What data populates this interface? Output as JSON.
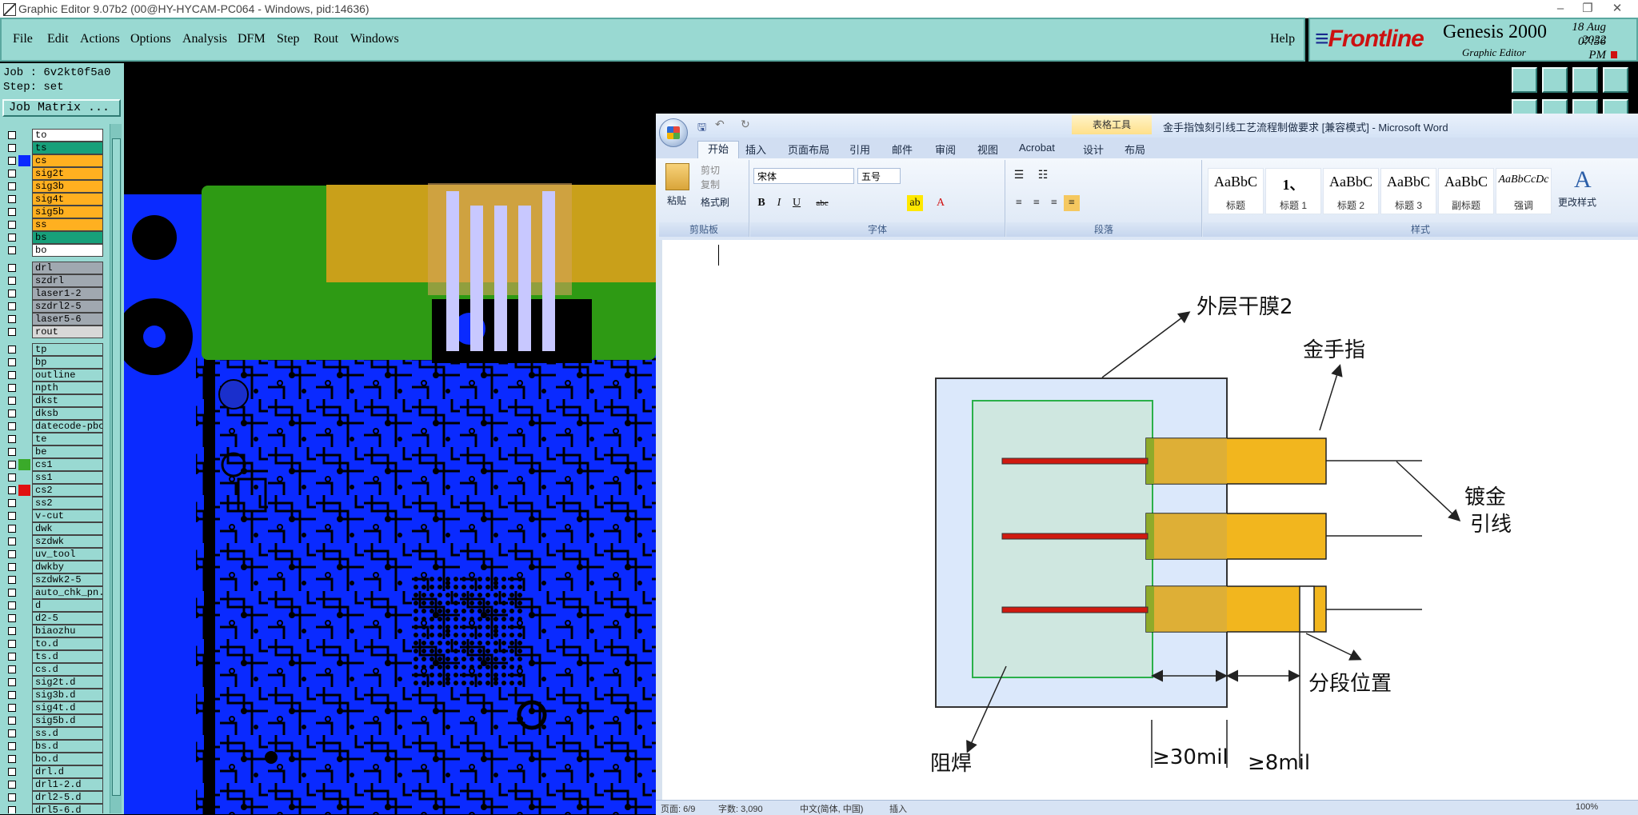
{
  "app_title": "Graphic Editor 9.07b2 (00@HY-HYCAM-PC064 - Windows, pid:14636)",
  "menu": [
    "File",
    "Edit",
    "Actions",
    "Options",
    "Analysis",
    "DFM",
    "Step",
    "Rout",
    "Windows"
  ],
  "help_label": "Help",
  "brand": {
    "logo": "Frontline",
    "product": "Genesis 2000",
    "module": "Graphic Editor",
    "date": "18 Aug 2022",
    "time": "07:56 PM"
  },
  "job_label": "Job : 6v2kt0f5a0",
  "step_label": "Step: set",
  "job_matrix_label": "Job Matrix ...",
  "layers": [
    {
      "name": "to",
      "color": "#ffffff",
      "swatch": ""
    },
    {
      "name": "ts",
      "color": "#17a07a",
      "swatch": ""
    },
    {
      "name": "cs",
      "color": "#ffb020",
      "swatch": "#0a2aff"
    },
    {
      "name": "sig2t",
      "color": "#ffb020",
      "swatch": ""
    },
    {
      "name": "sig3b",
      "color": "#ffb020",
      "swatch": ""
    },
    {
      "name": "sig4t",
      "color": "#ffb020",
      "swatch": ""
    },
    {
      "name": "sig5b",
      "color": "#ffb020",
      "swatch": ""
    },
    {
      "name": "ss",
      "color": "#ffb020",
      "swatch": ""
    },
    {
      "name": "bs",
      "color": "#17a07a",
      "swatch": ""
    },
    {
      "name": "bo",
      "color": "#ffffff",
      "swatch": ""
    },
    {
      "sep": true
    },
    {
      "name": "drl",
      "color": "#a0a8b0",
      "swatch": ""
    },
    {
      "name": "szdrl",
      "color": "#a0a8b0",
      "swatch": ""
    },
    {
      "name": "laser1-2",
      "color": "#a0a8b0",
      "swatch": ""
    },
    {
      "name": "szdrl2-5",
      "color": "#a0a8b0",
      "swatch": ""
    },
    {
      "name": "laser5-6",
      "color": "#a0a8b0",
      "swatch": ""
    },
    {
      "name": "rout",
      "color": "#d8d8d8",
      "swatch": ""
    },
    {
      "sep": true
    },
    {
      "name": "tp",
      "color": "#99d9d2",
      "swatch": ""
    },
    {
      "name": "bp",
      "color": "#99d9d2",
      "swatch": ""
    },
    {
      "name": "outline",
      "color": "#99d9d2",
      "swatch": ""
    },
    {
      "name": "npth",
      "color": "#99d9d2",
      "swatch": ""
    },
    {
      "name": "dkst",
      "color": "#99d9d2",
      "swatch": ""
    },
    {
      "name": "dksb",
      "color": "#99d9d2",
      "swatch": ""
    },
    {
      "name": "datecode-pbc",
      "color": "#99d9d2",
      "swatch": ""
    },
    {
      "name": "te",
      "color": "#99d9d2",
      "swatch": ""
    },
    {
      "name": "be",
      "color": "#99d9d2",
      "swatch": ""
    },
    {
      "name": "cs1",
      "color": "#99d9d2",
      "swatch": "#3aaa2a"
    },
    {
      "name": "ss1",
      "color": "#99d9d2",
      "swatch": ""
    },
    {
      "name": "cs2",
      "color": "#99d9d2",
      "swatch": "#e01010"
    },
    {
      "name": "ss2",
      "color": "#99d9d2",
      "swatch": ""
    },
    {
      "name": "v-cut",
      "color": "#99d9d2",
      "swatch": ""
    },
    {
      "name": "dwk",
      "color": "#99d9d2",
      "swatch": ""
    },
    {
      "name": "szdwk",
      "color": "#99d9d2",
      "swatch": ""
    },
    {
      "name": "uv_tool",
      "color": "#99d9d2",
      "swatch": ""
    },
    {
      "name": "dwkby",
      "color": "#99d9d2",
      "swatch": ""
    },
    {
      "name": "szdwk2-5",
      "color": "#99d9d2",
      "swatch": ""
    },
    {
      "name": "auto_chk_pn.",
      "color": "#99d9d2",
      "swatch": ""
    },
    {
      "name": "d",
      "color": "#99d9d2",
      "swatch": ""
    },
    {
      "name": "d2-5",
      "color": "#99d9d2",
      "swatch": ""
    },
    {
      "name": "biaozhu",
      "color": "#99d9d2",
      "swatch": ""
    },
    {
      "name": "to.d",
      "color": "#99d9d2",
      "swatch": ""
    },
    {
      "name": "ts.d",
      "color": "#99d9d2",
      "swatch": ""
    },
    {
      "name": "cs.d",
      "color": "#99d9d2",
      "swatch": ""
    },
    {
      "name": "sig2t.d",
      "color": "#99d9d2",
      "swatch": ""
    },
    {
      "name": "sig3b.d",
      "color": "#99d9d2",
      "swatch": ""
    },
    {
      "name": "sig4t.d",
      "color": "#99d9d2",
      "swatch": ""
    },
    {
      "name": "sig5b.d",
      "color": "#99d9d2",
      "swatch": ""
    },
    {
      "name": "ss.d",
      "color": "#99d9d2",
      "swatch": ""
    },
    {
      "name": "bs.d",
      "color": "#99d9d2",
      "swatch": ""
    },
    {
      "name": "bo.d",
      "color": "#99d9d2",
      "swatch": ""
    },
    {
      "name": "drl.d",
      "color": "#99d9d2",
      "swatch": ""
    },
    {
      "name": "drl1-2.d",
      "color": "#99d9d2",
      "swatch": ""
    },
    {
      "name": "drl2-5.d",
      "color": "#99d9d2",
      "swatch": ""
    },
    {
      "name": "drl5-6.d",
      "color": "#99d9d2",
      "swatch": ""
    }
  ],
  "word": {
    "title": "金手指蚀刻引线工艺流程制做要求 [兼容模式] - Microsoft Word",
    "context_tab": "表格工具",
    "tabs": [
      "开始",
      "插入",
      "页面布局",
      "引用",
      "邮件",
      "审阅",
      "视图",
      "Acrobat",
      "设计",
      "布局"
    ],
    "clipboard": {
      "paste": "粘贴",
      "cut": "剪切",
      "copy": "复制",
      "format_painter": "格式刷",
      "group": "剪贴板"
    },
    "font": {
      "name": "宋体",
      "size": "五号",
      "group": "字体"
    },
    "paragraph_group": "段落",
    "styles": [
      {
        "preview": "AaBbC",
        "label": "标题"
      },
      {
        "preview": "1、",
        "label": "标题 1"
      },
      {
        "preview": "AaBbC",
        "label": "标题 2"
      },
      {
        "preview": "AaBbC",
        "label": "标题 3"
      },
      {
        "preview": "AaBbC",
        "label": "副标题"
      },
      {
        "preview": "AaBbCcDc",
        "label": "强调"
      }
    ],
    "change_styles": "更改样式",
    "styles_group": "样式",
    "diagram": {
      "outer_dry_film": "外层干膜2",
      "gold_finger": "金手指",
      "plating_lead_1": "镀金",
      "plating_lead_2": "引线",
      "segment_position": "分段位置",
      "solder_mask": "阻焊",
      "dim_30": "≥30mil",
      "dim_8": "≥8mil"
    },
    "status": {
      "page": "页面: 6/9",
      "words": "字数: 3,090",
      "lang": "中文(简体, 中国)",
      "mode": "插入",
      "zoom": "100%"
    }
  }
}
